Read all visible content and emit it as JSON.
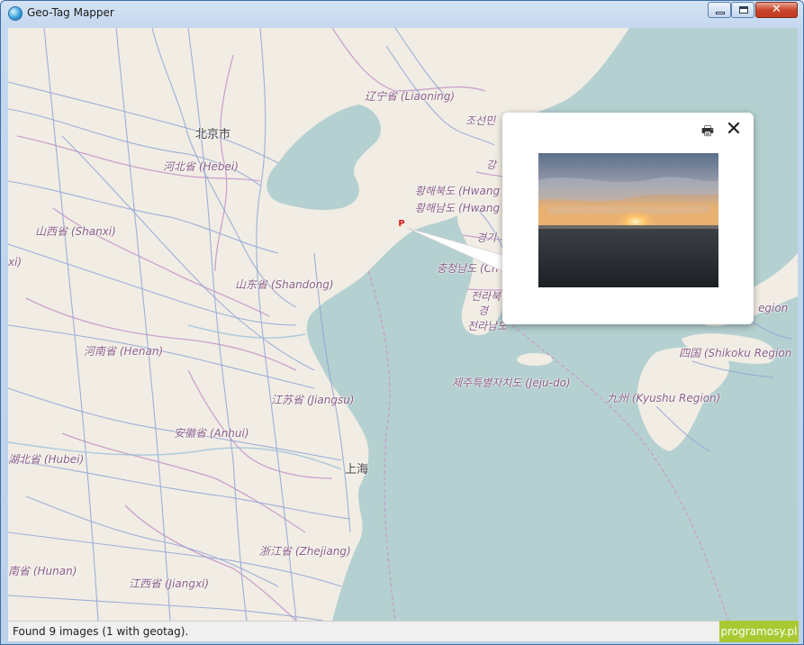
{
  "window": {
    "title": "Geo-Tag Mapper",
    "close_glyph": "✕"
  },
  "map": {
    "labels": {
      "beijing": "北京市",
      "liaoning": "辽宁省 (Liaoning)",
      "hebei": "河北省 (Hebei)",
      "shanxi": "山西省 (Shanxi)",
      "shandong": "山东省 (Shandong)",
      "henan": "河南省 (Henan)",
      "jiangsu": "江苏省 (Jiangsu)",
      "anhui": "安徽省 (Anhui)",
      "shanghai": "上海",
      "hubei": "湖北省 (Hubei)",
      "zhejiang": "浙江省 (Zhejiang)",
      "hunan": "南省 (Hunan)",
      "jiangxi": "江西省 (Jiangxi)",
      "joseon": "조선민",
      "hwanghae_n": "황해북도 (Hwang",
      "hwanghae_s": "황해남도 (Hwang",
      "gyeonggi": "경기",
      "chungcheong": "충청남도 (Ch",
      "jeolla_n": "전라북",
      "jeolla_s": "전라남도",
      "jeju": "제주특별자치도 (Jeju-do)",
      "kyushu": "九州 (Kyushu Region)",
      "shikoku": "四国 (Shikoku Region",
      "region_edge": "egion",
      "xi_fragment": "xi)",
      "gang": "강",
      "gyeong": "경"
    },
    "marker_letter": "P",
    "colors": {
      "sea": "#b5d0d0",
      "land": "#f1ede4",
      "roads": "#8fa4d6",
      "borders": "#c799c9",
      "marker": "#e01a1a"
    }
  },
  "popup": {
    "print_icon": "🖶",
    "close_icon": "✕"
  },
  "status": {
    "text": "Found 9 images (1 with geotag).",
    "brand": "programosy.pl"
  }
}
